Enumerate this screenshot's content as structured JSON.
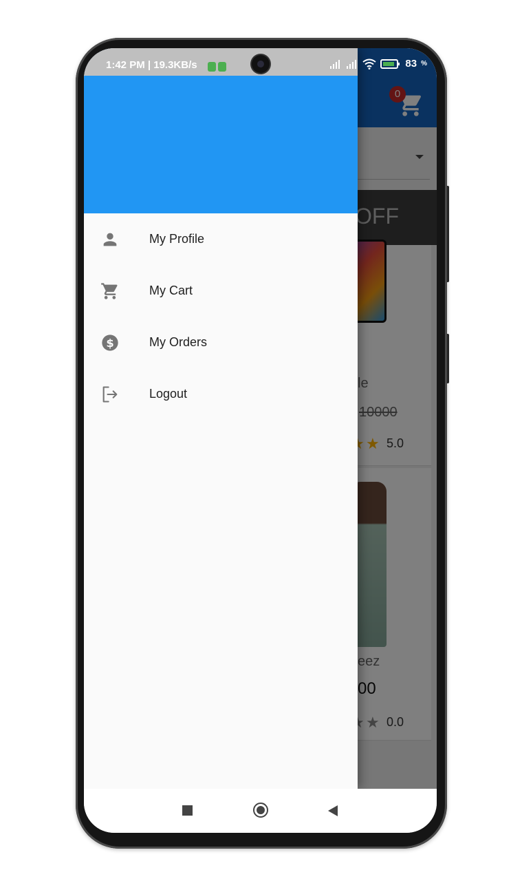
{
  "status_bar": {
    "time": "1:42 PM | 19.3KB/s",
    "battery": "83"
  },
  "background_app": {
    "cart_count": "0",
    "banner_text": "OFF",
    "product1_name_fragment": "le",
    "product1_old_price_fragment": "10000",
    "product1_rating": "5.0",
    "product2_name_fragment": "eez",
    "product2_price_fragment": "00",
    "product2_rating": "0.0"
  },
  "drawer": {
    "header_color": "#2196F3",
    "items": [
      {
        "label": "My Profile",
        "icon": "person-icon"
      },
      {
        "label": "My Cart",
        "icon": "cart-icon"
      },
      {
        "label": "My Orders",
        "icon": "dollar-circle-icon"
      },
      {
        "label": "Logout",
        "icon": "logout-icon"
      }
    ]
  },
  "colors": {
    "drawer_header": "#2196F3",
    "app_bar": "#1565C0",
    "menu_icon": "#757575",
    "menu_text": "#212121"
  }
}
